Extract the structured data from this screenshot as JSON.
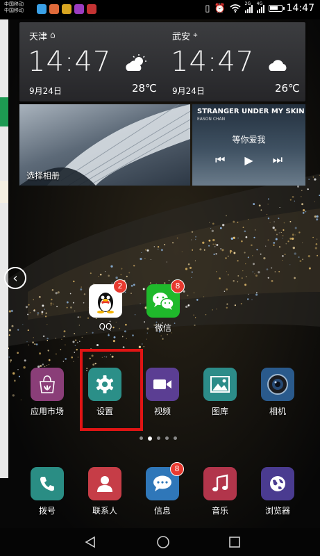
{
  "status_bar": {
    "carrier_1": "中国移动",
    "carrier_2": "中国移动",
    "network_badge_1": "2G",
    "network_badge_2": "4G",
    "time": "14:47",
    "icons": [
      "vibrate-icon",
      "alarm-icon",
      "wifi-icon",
      "signal-icon",
      "signal-icon",
      "battery-icon"
    ],
    "battery_level": 0.7
  },
  "weather": {
    "left": {
      "city": "天津",
      "city_icon": "home-icon",
      "time": "14:47",
      "date": "9月24日",
      "temp": "28℃",
      "condition_icon": "partly-cloudy-icon"
    },
    "right": {
      "city": "武安",
      "city_icon": "location-pin-icon",
      "time": "14:47",
      "date": "9月24日",
      "temp": "26℃",
      "condition_icon": "cloudy-icon"
    }
  },
  "photo_widget": {
    "label": "选择相册"
  },
  "music_widget": {
    "song": "STRANGER UNDER MY SKIN",
    "artist": "EASON CHAN",
    "track": "等你爱我",
    "controls": [
      "previous-icon",
      "play-icon",
      "next-icon"
    ]
  },
  "apps_row_1": [
    {
      "label": "QQ",
      "badge": "2",
      "icon": "qq-icon",
      "color": "#ffffff"
    },
    {
      "label": "微信",
      "badge": "8",
      "icon": "wechat-icon",
      "color": "#1fb92b"
    }
  ],
  "apps_row_2": [
    {
      "label": "应用市场",
      "icon": "app-market-icon",
      "color": "#8a3e78"
    },
    {
      "label": "设置",
      "icon": "gear-icon",
      "color": "#2b8f88"
    },
    {
      "label": "视频",
      "icon": "video-icon",
      "color": "#5b3e93"
    },
    {
      "label": "图库",
      "icon": "gallery-icon",
      "color": "#2c8c89"
    },
    {
      "label": "相机",
      "icon": "camera-icon",
      "color": "#2a5a8c"
    }
  ],
  "dock": [
    {
      "label": "拨号",
      "icon": "phone-icon",
      "color": "#2a8d84"
    },
    {
      "label": "联系人",
      "icon": "contacts-icon",
      "color": "#c63d47"
    },
    {
      "label": "信息",
      "badge": "8",
      "icon": "message-icon",
      "color": "#2f77b9"
    },
    {
      "label": "音乐",
      "icon": "music-icon",
      "color": "#b2354b"
    },
    {
      "label": "浏览器",
      "icon": "browser-icon",
      "color": "#4a3b90"
    }
  ],
  "page_indicator": {
    "count": 5,
    "active": 1
  },
  "highlight_color": "#e01414",
  "nav_bar": [
    "back-icon",
    "home-icon",
    "recents-icon"
  ]
}
